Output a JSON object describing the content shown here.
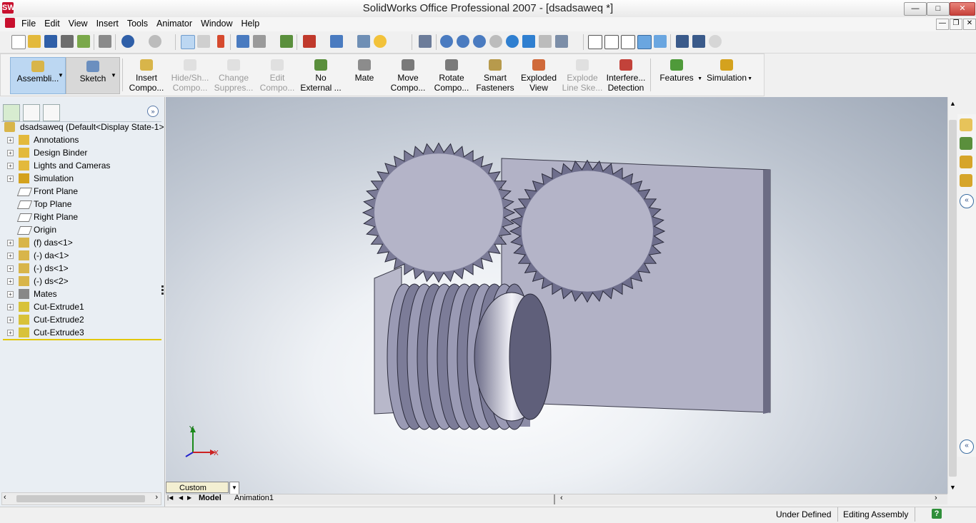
{
  "window": {
    "title": "SolidWorks Office Professional 2007 - [dsadsaweq *]",
    "minimize": "—",
    "maximize": "□",
    "close": "✕",
    "app_icon": "SW"
  },
  "menu": {
    "items": [
      "File",
      "Edit",
      "View",
      "Insert",
      "Tools",
      "Animator",
      "Window",
      "Help"
    ]
  },
  "doc_buttons": {
    "minimize": "—",
    "restore": "❐",
    "close": "✕"
  },
  "command_tabs": {
    "assembly": "Assembli...",
    "sketch": "Sketch"
  },
  "commands": [
    {
      "label1": "Insert",
      "label2": "Compo...",
      "disabled": false,
      "color": "#d8b54a"
    },
    {
      "label1": "Hide/Sh...",
      "label2": "Compo...",
      "disabled": true,
      "color": "#bcbcbc"
    },
    {
      "label1": "Change",
      "label2": "Suppres...",
      "disabled": true,
      "color": "#bcbcbc"
    },
    {
      "label1": "Edit",
      "label2": "Compo...",
      "disabled": true,
      "color": "#bcbcbc"
    },
    {
      "label1": "No",
      "label2": "External ...",
      "disabled": false,
      "color": "#5a8f3c"
    },
    {
      "label1": "Mate",
      "label2": "",
      "disabled": false,
      "color": "#8c8c8c"
    },
    {
      "label1": "Move",
      "label2": "Compo...",
      "disabled": false,
      "color": "#7a7a7a"
    },
    {
      "label1": "Rotate",
      "label2": "Compo...",
      "disabled": false,
      "color": "#7a7a7a"
    },
    {
      "label1": "Smart",
      "label2": "Fasteners",
      "disabled": false,
      "color": "#b79a4c"
    },
    {
      "label1": "Exploded",
      "label2": "View",
      "disabled": false,
      "color": "#d06a3a"
    },
    {
      "label1": "Explode",
      "label2": "Line Ske...",
      "disabled": true,
      "color": "#bcbcbc"
    },
    {
      "label1": "Interfere...",
      "label2": "Detection",
      "disabled": false,
      "color": "#c2423a"
    },
    {
      "label1": "Features",
      "label2": "",
      "disabled": false,
      "color": "#4f9a3a"
    },
    {
      "label1": "Simulation",
      "label2": "",
      "disabled": false,
      "color": "#d4a21e"
    }
  ],
  "tree": {
    "root": "dsadsaweq  (Default<Display State-1>",
    "items": [
      {
        "label": "Annotations",
        "expandable": true
      },
      {
        "label": "Design Binder",
        "expandable": true
      },
      {
        "label": "Lights and Cameras",
        "expandable": true
      },
      {
        "label": "Simulation",
        "expandable": true
      },
      {
        "label": "Front Plane",
        "expandable": false
      },
      {
        "label": "Top Plane",
        "expandable": false
      },
      {
        "label": "Right Plane",
        "expandable": false
      },
      {
        "label": "Origin",
        "expandable": false
      },
      {
        "label": "(f) das<1>",
        "expandable": true
      },
      {
        "label": "(-) da<1>",
        "expandable": true
      },
      {
        "label": "(-) ds<1>",
        "expandable": true
      },
      {
        "label": "(-) ds<2>",
        "expandable": true
      },
      {
        "label": "Mates",
        "expandable": true
      },
      {
        "label": "Cut-Extrude1",
        "expandable": true
      },
      {
        "label": "Cut-Extrude2",
        "expandable": true
      },
      {
        "label": "Cut-Extrude3",
        "expandable": true
      }
    ]
  },
  "bottom": {
    "custom": "Custom",
    "tabs": [
      "Model",
      "Animation1"
    ]
  },
  "status": {
    "defined": "Under Defined",
    "mode": "Editing Assembly",
    "help": "?"
  },
  "axes": {
    "x": "X",
    "y": "Y"
  },
  "colors": {
    "accent": "#bcd7f2",
    "title_close": "#c7413a"
  }
}
